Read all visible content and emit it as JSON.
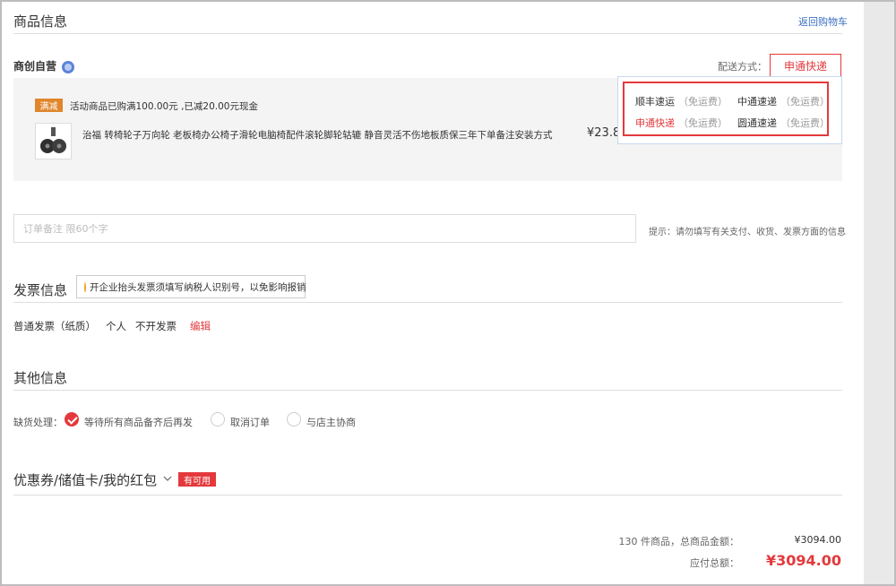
{
  "goods_section": {
    "title": "商品信息",
    "back_link": "返回购物车",
    "shop_name": "商创自营",
    "shipping_label": "配送方式：",
    "shipping_selected": "申通快递",
    "promo_badge": "满减",
    "promo_text": "活动商品已购满100.00元 ,已减20.00元现金",
    "product_name": "治福 转椅轮子万向轮 老板椅办公椅子滑轮电脑椅配件滚轮脚轮轱辘 静音灵活不伤地板质保三年下单备注安装方式",
    "product_price": "¥23.8",
    "shipping_options": [
      {
        "name": "顺丰速运",
        "fee": "（免运费）"
      },
      {
        "name": "中通速递",
        "fee": "（免运费）"
      },
      {
        "name": "申通快递",
        "fee": "（免运费）"
      },
      {
        "name": "圆通速递",
        "fee": "（免运费）"
      }
    ]
  },
  "remark": {
    "placeholder": "订单备注 限60个字",
    "hint": "提示：请勿填写有关支付、收货、发票方面的信息"
  },
  "invoice": {
    "title": "发票信息",
    "tip": "开企业抬头发票须填写纳税人识别号，以免影响报销",
    "type": "普通发票（纸质）",
    "title_type": "个人",
    "content": "不开发票",
    "edit": "编辑"
  },
  "other": {
    "title": "其他信息",
    "stockout_label": "缺货处理：",
    "options": [
      "等待所有商品备齐后再发",
      "取消订单",
      "与店主协商"
    ]
  },
  "coupon": {
    "title": "优惠券/储值卡/我的红包",
    "badge": "有可用"
  },
  "summary": {
    "count_label": "130 件商品，总商品金额：",
    "goods_total": "¥3094.00",
    "payable_label": "应付总额：",
    "payable": "¥3094.00"
  },
  "colors": {
    "accent_red": "#e4393c",
    "link_blue": "#3b6fc0",
    "promo_orange": "#e0862c"
  }
}
